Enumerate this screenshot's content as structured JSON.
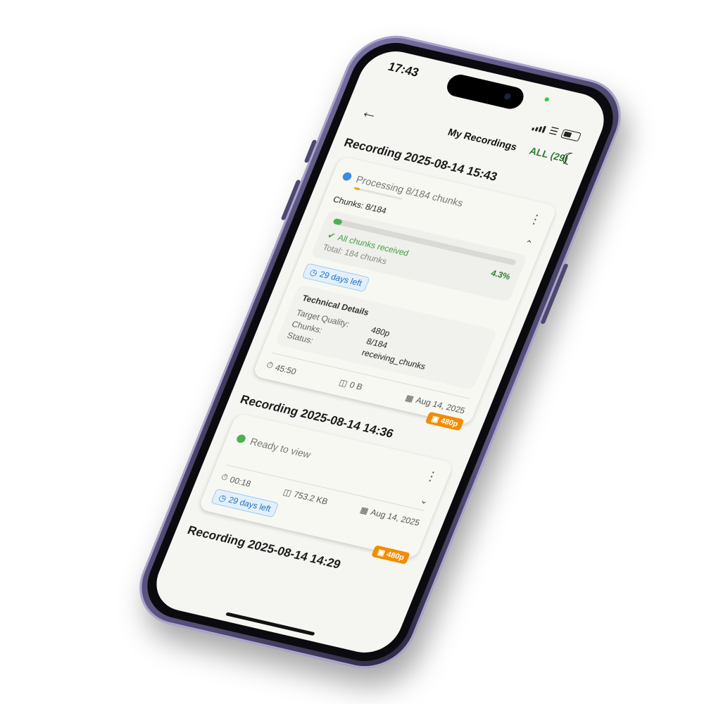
{
  "status_bar": {
    "time": "17:43"
  },
  "appbar": {
    "title": "My Recordings",
    "filter": "ALL (29)"
  },
  "groups": [
    {
      "title": "Recording 2025-08-14 15:43",
      "status": "Processing 8/184 chunks",
      "status_color": "#3b8be0",
      "chunks_label": "Chunks: 8/184",
      "progress_fraction": 0.043,
      "received": "All chunks received",
      "percent": "4.3%",
      "total": "Total: 184 chunks",
      "retention": "29 days left",
      "tech": {
        "title": "Technical Details",
        "rows": [
          {
            "k": "Target Quality:",
            "v": "480p"
          },
          {
            "k": "Chunks:",
            "v": "8/184"
          },
          {
            "k": "Status:",
            "v": "receiving_chunks"
          }
        ]
      },
      "duration": "45:50",
      "size": "0 B",
      "date": "Aug 14, 2025",
      "quality": "480p"
    },
    {
      "title": "Recording 2025-08-14 14:36",
      "status": "Ready to view",
      "status_color": "#4caf50",
      "retention": "29 days left",
      "duration": "00:18",
      "size": "753.2 KB",
      "date": "Aug 14, 2025",
      "quality": "480p"
    },
    {
      "title": "Recording 2025-08-14 14:29"
    }
  ]
}
